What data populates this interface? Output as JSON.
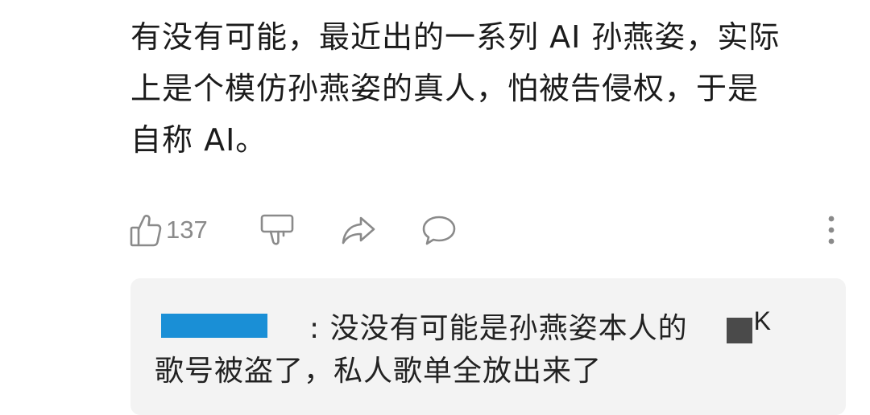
{
  "comment": {
    "lines": [
      "有没有可能，最近出的一系列 AI 孙燕姿，实际",
      "上是个模仿孙燕姿的真人，怕被告侵权，于是",
      "自称 AI。"
    ]
  },
  "actions": {
    "like_count": "137",
    "icons": [
      "thumbs-up-icon",
      "thumbs-down-icon",
      "share-icon",
      "comment-icon",
      "more-vertical-icon"
    ]
  },
  "reply": {
    "text_line1": ": 没没有可能是孙燕姿本人的",
    "k_label": "K",
    "text_line2": "歌号被盗了，私人歌单全放出来了"
  },
  "colors": {
    "text": "#1b1b1b",
    "icon": "#8a8a8a",
    "reply_bg": "#f3f3f3",
    "redact_blue": "#1a8fd6",
    "redact_gray": "#4a4a4a"
  }
}
